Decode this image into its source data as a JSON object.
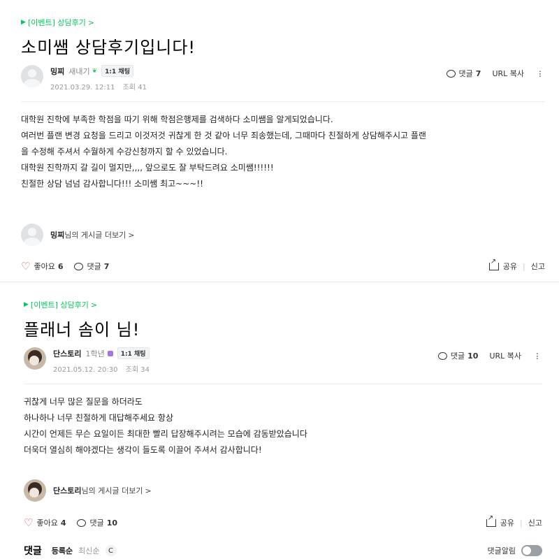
{
  "posts": [
    {
      "category": "[이벤트] 상담후기",
      "title": "소미쌤 상담후기입니다!",
      "author": "밍찌",
      "grade": "새내기",
      "chat": "1:1 채팅",
      "date": "2021.03.29. 12:11",
      "views": "조회 41",
      "comment_label": "댓글",
      "comment_count": "7",
      "url_label": "URL 복사",
      "content": [
        "대학원 진학에 부족한 학점을 따기 위해 학점은행제를 검색하다 소미쌤을 알게되었습니다.",
        "여러번 플랜 변경 요청을 드리고 이것저것 귀찮게 한 것 같아 너무 죄송했는데, 그때마다 친절하게 상담해주시고 플랜",
        "을 수정해 주셔서 수월하게 수강신청까지 할 수 있었습니다.",
        "대학원 진학까지 갈 길이 멀지만,,,, 앞으로도 잘 부탁드려요 소미쌤!!!!!!",
        "친절한 상담 넘넘 감사합니다!!! 소미쌤 최고~~~!!"
      ],
      "more_suffix": "님의 게시글 더보기",
      "like_label": "좋아요",
      "like_count": "6",
      "share_label": "공유",
      "report_label": "신고"
    },
    {
      "category": "[이벤트] 상담후기",
      "title": "플래너 솜이 님!",
      "author": "단스토리",
      "grade": "1학년",
      "chat": "1:1 채팅",
      "date": "2021.05.12. 20:30",
      "views": "조회 34",
      "comment_label": "댓글",
      "comment_count": "10",
      "url_label": "URL 복사",
      "content": [
        "귀찮게 너무 많은 질문을 하더라도",
        "하나하나 너무 친절하게 대답해주세요 항상",
        "시간이 언제든 무슨 요일이든 최대한 빨리 답장해주시려는 모습에 감동받았습니다",
        "더욱더 열심히 해야겠다는 생각이 들도록 이끌어 주셔서 감사합니다!"
      ],
      "more_suffix": "님의 게시글 더보기",
      "like_label": "좋아요",
      "like_count": "4",
      "share_label": "공유",
      "report_label": "신고"
    }
  ],
  "comments_bar": {
    "title": "댓글",
    "sort_register": "등록순",
    "sort_latest": "최신순",
    "refresh": "C",
    "alarm": "댓글알림"
  },
  "colors": {
    "accent": "#03c75a",
    "heart": "#e54b4b"
  }
}
